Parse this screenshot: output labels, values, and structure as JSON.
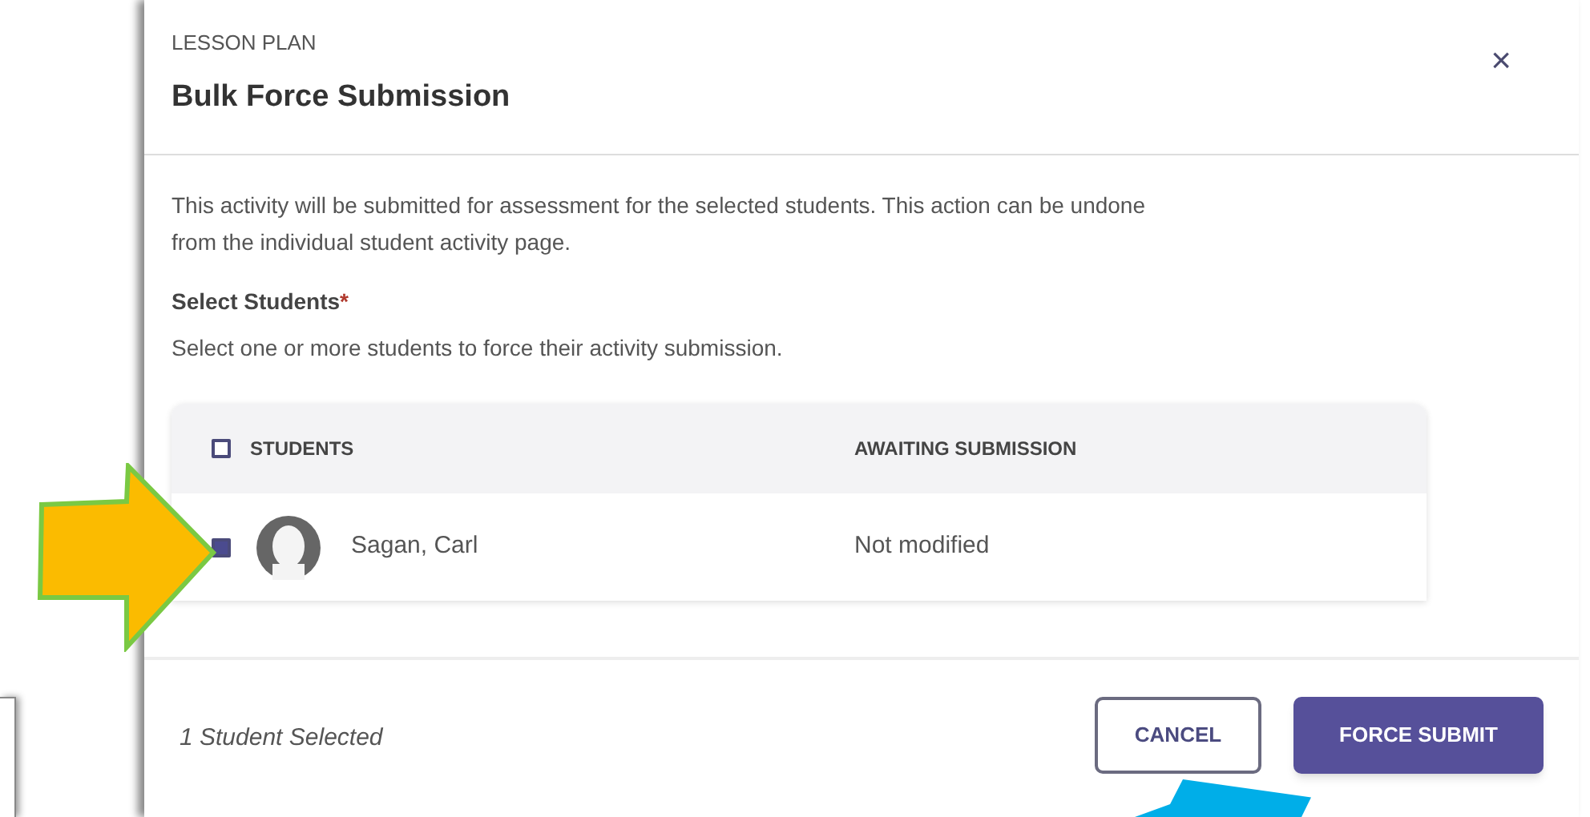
{
  "modal": {
    "eyebrow": "LESSON PLAN",
    "title": "Bulk Force Submission",
    "close": "×",
    "description": "This activity will be submitted for assessment for the selected students. This action can be undone from the individual student activity page.",
    "field_label": "Select Students",
    "required_mark": "*",
    "field_hint": "Select one or more students to force their activity submission.",
    "table": {
      "select_all": {
        "checked": false
      },
      "columns": [
        "STUDENTS",
        "AWAITING SUBMISSION"
      ],
      "rows": [
        {
          "checked": true,
          "name": "Sagan, Carl",
          "status": "Not modified"
        }
      ]
    },
    "footer": {
      "status": "1 Student Selected",
      "buttons": [
        {
          "kind": "outline",
          "label": "CANCEL"
        },
        {
          "kind": "primary",
          "label": "FORCE SUBMIT"
        }
      ]
    }
  }
}
